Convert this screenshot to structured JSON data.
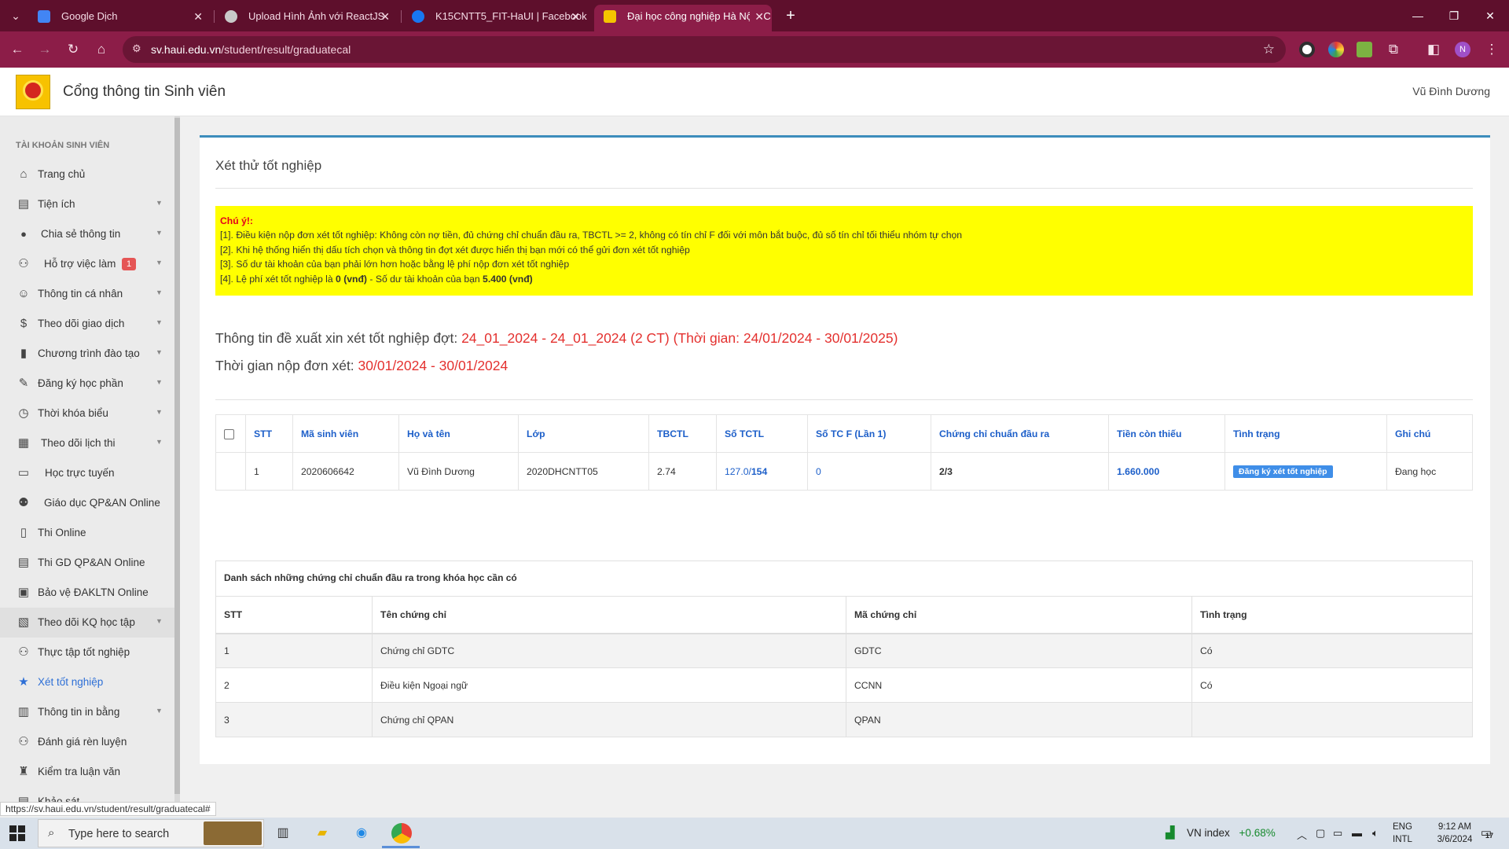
{
  "browser": {
    "tabs": [
      {
        "title": "Google Dịch",
        "favicon_color": "#4285f4"
      },
      {
        "title": "Upload Hình Ảnh với ReactJS",
        "favicon_color": "#c9c9c9"
      },
      {
        "title": "K15CNTT5_FIT-HaUI | Facebook",
        "favicon_color": "#1877f2"
      },
      {
        "title": "Đại học công nghiệp Hà Nội - C",
        "favicon_color": "#f5c400"
      }
    ],
    "url_host": "sv.haui.edu.vn",
    "url_path": "/student/result/graduatecal",
    "profile_initial": "N"
  },
  "site": {
    "title": "Cổng thông tin Sinh viên",
    "user": "Vũ Đình Dương"
  },
  "sidebar": {
    "heading": "TÀI KHOẢN SINH VIÊN",
    "items": [
      {
        "label": "Trang chủ",
        "icon": "home-icon",
        "glyph": "⌂"
      },
      {
        "label": "Tiện ích",
        "icon": "book-icon",
        "glyph": "▤"
      },
      {
        "label": "Chia sẻ thông tin",
        "icon": "chat-icon",
        "glyph": "💬"
      },
      {
        "label": "Hỗ trợ việc làm",
        "icon": "network-icon",
        "glyph": "⚇",
        "badge": "1"
      },
      {
        "label": "Thông tin cá nhân",
        "icon": "user-face-icon",
        "glyph": "☺"
      },
      {
        "label": "Theo dõi giao dịch",
        "icon": "dollar-icon",
        "glyph": "$"
      },
      {
        "label": "Chương trình đào tạo",
        "icon": "notebook-icon",
        "glyph": "▮"
      },
      {
        "label": "Đăng ký học phần",
        "icon": "pen-icon",
        "glyph": "✎"
      },
      {
        "label": "Thời khóa biểu",
        "icon": "clock-icon",
        "glyph": "◷"
      },
      {
        "label": "Theo dõi lịch thi",
        "icon": "calendar-icon",
        "glyph": "▦"
      },
      {
        "label": "Học trực tuyến",
        "icon": "monitor-icon",
        "glyph": "▭"
      },
      {
        "label": "Giáo dục QP&AN Online",
        "icon": "people-icon",
        "glyph": "⚉"
      },
      {
        "label": "Thi Online",
        "icon": "exam-icon",
        "glyph": "▯"
      },
      {
        "label": "Thi GD QP&AN Online",
        "icon": "document-icon",
        "glyph": "▤"
      },
      {
        "label": "Bảo vệ ĐAKLTN Online",
        "icon": "thesis-icon",
        "glyph": "▣"
      },
      {
        "label": "Theo dõi KQ học tập",
        "icon": "report-icon",
        "glyph": "▧"
      },
      {
        "label": "Thực tập tốt nghiệp",
        "icon": "sitemap-icon",
        "glyph": "⚇"
      },
      {
        "label": "Xét tốt nghiệp",
        "icon": "star-badge-icon",
        "glyph": "★"
      },
      {
        "label": "Thông tin in bằng",
        "icon": "diploma-icon",
        "glyph": "▥"
      },
      {
        "label": "Đánh giá rèn luyện",
        "icon": "hierarchy-icon",
        "glyph": "⚇"
      },
      {
        "label": "Kiểm tra luận văn",
        "icon": "stamp-icon",
        "glyph": "♜"
      },
      {
        "label": "Khảo sát",
        "icon": "survey-icon",
        "glyph": "▤"
      }
    ]
  },
  "page": {
    "title": "Xét thử tốt nghiệp",
    "notice": {
      "heading": "Chú ý!:",
      "line1": "[1]. Điều kiện nộp đơn xét tốt nghiệp: Không còn nợ tiền, đủ chứng chỉ chuẩn đầu ra, TBCTL >= 2, không có tín chỉ F đối với môn bắt buộc, đủ số tín chỉ tối thiểu nhóm tự chọn",
      "line2": "[2]. Khi hệ thống hiển thị dấu tích chọn và thông tin đợt xét được hiển thị bạn mới có thể gửi đơn xét tốt nghiệp",
      "line3": "[3]. Số dư tài khoản của bạn phải lớn hơn hoặc bằng lệ phí nộp đơn xét tốt nghiệp",
      "line4_a": "[4]. Lệ phí xét tốt nghiệp là ",
      "line4_fee": "0 (vnđ)",
      "line4_b": " - Số dư tài khoản của bạn ",
      "line4_balance": "5.400 (vnđ)"
    },
    "proposal_label": "Thông tin đề xuất xin xét tốt nghiệp đợt: ",
    "proposal_value": "24_01_2024 - 24_01_2024 (2 CT) (Thời gian: 24/01/2024 - 30/01/2025)",
    "deadline_label": "Thời gian nộp đơn xét: ",
    "deadline_value": "30/01/2024 - 30/01/2024"
  },
  "grad_table": {
    "headers": [
      "STT",
      "Mã sinh viên",
      "Họ và tên",
      "Lớp",
      "TBCTL",
      "Số TCTL",
      "Số TC F (Lần 1)",
      "Chứng chỉ chuẩn đầu ra",
      "Tiền còn thiếu",
      "Tình trạng",
      "Ghi chú"
    ],
    "row": {
      "stt": "1",
      "student_id": "2020606642",
      "name": "Vũ Đình Dương",
      "class": "2020DHCNTT05",
      "gpa": "2.74",
      "credits_done": "127.0",
      "credits_total": "154",
      "f_credits": "0",
      "certificates": "2/3",
      "missing_money": "1.660.000",
      "status_button": "Đăng ký xét tốt nghiệp",
      "note": "Đang học"
    }
  },
  "cert_table": {
    "caption": "Danh sách những chứng chỉ chuẩn đầu ra trong khóa học cần có",
    "headers": [
      "STT",
      "Tên chứng chỉ",
      "Mã chứng chỉ",
      "Tình trạng"
    ],
    "rows": [
      {
        "stt": "1",
        "name": "Chứng chỉ GDTC",
        "code": "GDTC",
        "status": "Có"
      },
      {
        "stt": "2",
        "name": "Điều kiện Ngoại ngữ",
        "code": "CCNN",
        "status": "Có"
      },
      {
        "stt": "3",
        "name": "Chứng chỉ QPAN",
        "code": "QPAN",
        "status": ""
      }
    ]
  },
  "status_bar_link": "https://sv.haui.edu.vn/student/result/graduatecal#",
  "taskbar": {
    "search_placeholder": "Type here to search",
    "stock_name": "VN index",
    "stock_change": "+0.68%",
    "lang_line1": "ENG",
    "lang_line2": "INTL",
    "time": "9:12 AM",
    "date": "3/6/2024",
    "notifications": "17"
  }
}
